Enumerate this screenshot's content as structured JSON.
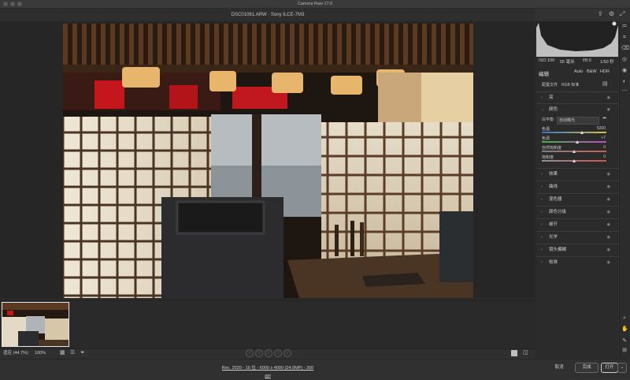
{
  "window": {
    "title": "Camera Raw 17.0"
  },
  "document": {
    "title": "DSC01061.ARW  ·  Sony ILCE-7M3"
  },
  "histogram": {
    "info": [
      "ISO 100",
      "55 毫米",
      "f/8.0",
      "1/50 秒"
    ]
  },
  "edit": {
    "heading": "编辑",
    "auto": "Auto",
    "bw": "B&W",
    "hdr": "HDR",
    "profile_label": "配置文件",
    "profile_value": "RGB 标准"
  },
  "color_section": {
    "title": "颜色",
    "wb_label": "白平衡",
    "wb_value": "自动曝光",
    "sliders": [
      {
        "label": "色温",
        "value": "5200",
        "pos": 0.62,
        "colors": [
          "#3a6fd0",
          "#d8c040"
        ]
      },
      {
        "label": "色调",
        "value": "+7",
        "pos": 0.55,
        "colors": [
          "#48b048",
          "#c048c0"
        ]
      },
      {
        "label": "自然饱和度",
        "value": "0",
        "pos": 0.5,
        "colors": [
          "#808080",
          "#c86060"
        ]
      },
      {
        "label": "饱和度",
        "value": "0",
        "pos": 0.5,
        "colors": [
          "#909090",
          "#d05050"
        ]
      }
    ]
  },
  "sections": [
    "亮",
    "颜色",
    "效果",
    "曲线",
    "混色器",
    "颜色分级",
    "细节",
    "光学",
    "镜头模糊",
    "校准"
  ],
  "bottom": {
    "fit": "适应 (44.7%)",
    "zoom": "100%",
    "stars": [
      "☆",
      "☆",
      "☆",
      "☆",
      "☆"
    ]
  },
  "footer": {
    "info": "Rec. 2020 - 16 位 - 6000 x 4000 (24.0MP) - 300 ppi",
    "cancel": "取消",
    "done": "完成",
    "open": "打开"
  }
}
